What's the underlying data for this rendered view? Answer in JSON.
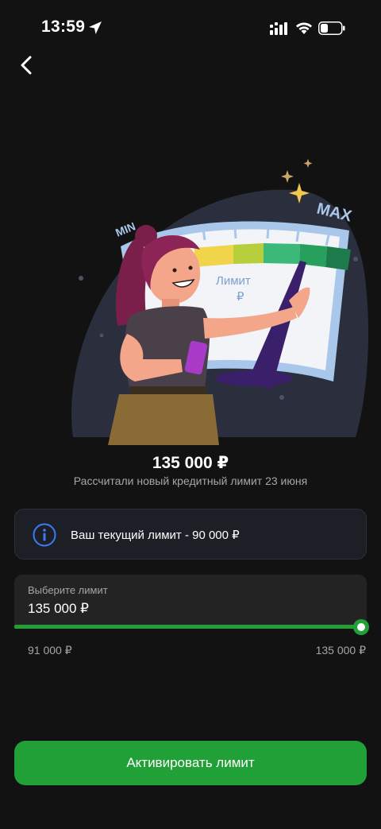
{
  "status_bar": {
    "time": "13:59",
    "icons": [
      "location-arrow-icon",
      "signal-icon",
      "wifi-icon",
      "battery-icon"
    ]
  },
  "nav": {
    "back_icon": "chevron-left-icon"
  },
  "illustration": {
    "min_label": "MIN",
    "max_label": "MAX",
    "gauge_label_line1": "Лимит",
    "gauge_label_line2": "₽"
  },
  "summary": {
    "amount": "135 000 ₽",
    "subtitle": "Рассчитали новый кредитный лимит 23 июня"
  },
  "info": {
    "icon": "info-icon",
    "text": "Ваш текущий лимит - 90 000 ₽"
  },
  "limit_selector": {
    "label": "Выберите лимит",
    "value": "135 000 ₽",
    "min": "91 000 ₽",
    "max": "135 000 ₽",
    "slider_fraction": 1.0
  },
  "actions": {
    "activate_label": "Активировать лимит"
  },
  "colors": {
    "background": "#121212",
    "accent_green": "#21a038",
    "info_blue": "#3d7bf2",
    "card_bg": "#1c1f26"
  }
}
